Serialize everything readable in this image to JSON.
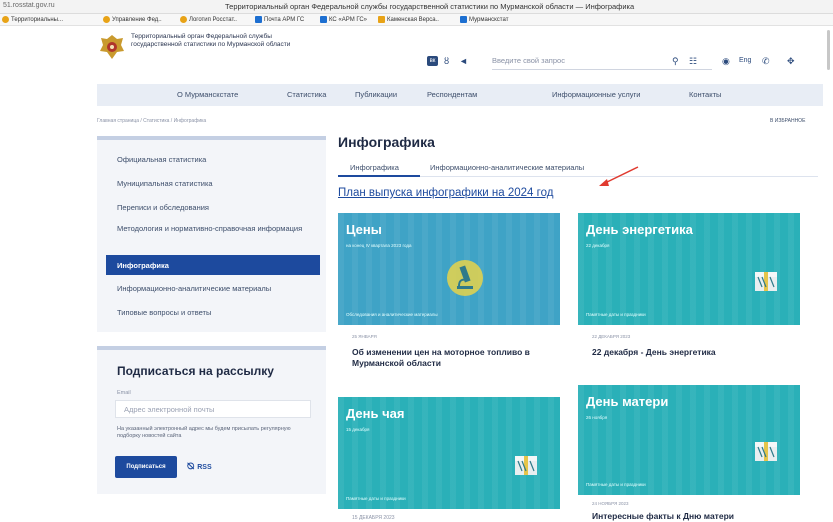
{
  "browser": {
    "url": "51.rosstat.gov.ru",
    "window_title": "Территориальный орган Федеральной службы государственной статистики по Мурманской области — Инфографика",
    "bookmarks": [
      {
        "label": "Территориальны...",
        "icon": "star-icon",
        "color": "#e8a317"
      },
      {
        "label": "Управление Фед..",
        "icon": "star-icon",
        "color": "#e8a317"
      },
      {
        "label": "Логотип Росстат..",
        "icon": "star-icon",
        "color": "#e8a317"
      },
      {
        "label": "Почта АРМ ГС",
        "icon": "mail-icon",
        "color": "#1d6fd1"
      },
      {
        "label": "КС «АРМ ГС»",
        "icon": "app-icon",
        "color": "#1d6fd1"
      },
      {
        "label": "Каменская Верса..",
        "icon": "app-icon",
        "color": "#e8a317"
      },
      {
        "label": "Мурманскстат",
        "icon": "app-icon",
        "color": "#1d6fd1"
      }
    ]
  },
  "header": {
    "org_name": "Территориальный орган Федеральной службы государственной статистики по Мурманской области",
    "search_placeholder": "Введите свой запрос",
    "lang": "Eng"
  },
  "nav": {
    "items": [
      "О Мурманскстате",
      "Статистика",
      "Публикации",
      "Респондентам",
      "Информационные услуги",
      "Контакты"
    ]
  },
  "breadcrumbs": "Главная страница / Статистика / Инфографика",
  "favorites": "В ИЗБРАННОЕ",
  "sidebar": {
    "items": [
      "Официальная статистика",
      "Муниципальная статистика",
      "Переписи и обследования",
      "Методология и нормативно-справочная информация",
      "Инфографика",
      "Информационно-аналитические материалы",
      "Типовые вопросы и ответы"
    ],
    "active": "Инфографика"
  },
  "subscribe": {
    "title": "Подписаться на рассылку",
    "email_label": "Email",
    "email_placeholder": "Адрес электронной почты",
    "note": "На указанный электронный адрес мы будем присылать регулярную подборку новостей сайта",
    "button": "Подписаться",
    "rss": "RSS"
  },
  "main": {
    "title": "Инфографика",
    "tabs": [
      "Инфографика",
      "Информационно-аналитические материалы"
    ],
    "plan_link": "План выпуска инфографики на 2024 год",
    "cards": [
      {
        "title": "Цены",
        "subtitle": "на конец IV квартала 2023 года",
        "category": "Обследования и аналитические материалы",
        "date": "25 ЯНВАРЯ",
        "caption": "Об изменении цен на моторное топливо в Мурманской области"
      },
      {
        "title": "День энергетика",
        "subtitle": "22 декабря",
        "category": "Памятные даты и праздники",
        "date": "22 ДЕКАБРЯ 2023",
        "caption": "22 декабря - День энергетика"
      },
      {
        "title": "День чая",
        "subtitle": "15 декабря",
        "category": "Памятные даты и праздники",
        "date": "15 ДЕКАБРЯ 2023",
        "caption": ""
      },
      {
        "title": "День матери",
        "subtitle": "26 ноября",
        "category": "Памятные даты и праздники",
        "date": "24 НОЯБРЯ 2023",
        "caption": "Интересные факты к Дню матери"
      }
    ]
  },
  "colors": {
    "brand_blue": "#1d4a9e",
    "card_teal": "#2ab0b8",
    "annotation_red": "#e03a2f"
  }
}
